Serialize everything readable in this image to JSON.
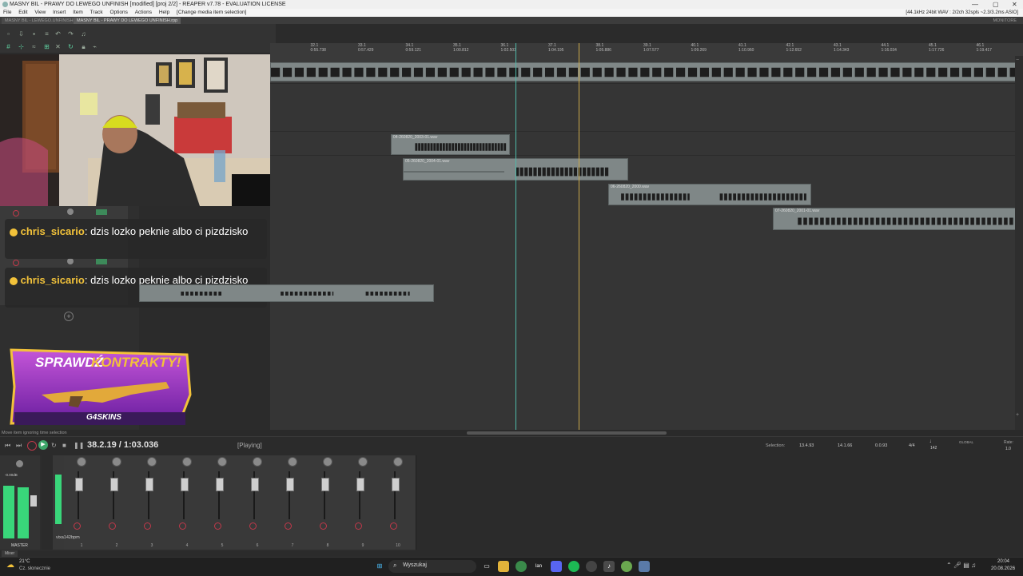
{
  "window": {
    "title": "MASNY BIL - PRAWY DO LEWEGO UNFINISH [modified] [proj 2/2] - REAPER v7.78 - EVALUATION LICENSE",
    "controls": [
      "—",
      "▢",
      "✕"
    ]
  },
  "menu": {
    "items": [
      "File",
      "Edit",
      "View",
      "Insert",
      "Item",
      "Track",
      "Options",
      "Actions",
      "Help"
    ],
    "status": "[Change media item selection]",
    "audio_info": "[44.1kHz 24bit WAV : 2/2ch 32spls ~2.3/3.2ms ASIO]"
  },
  "tabs": [
    "MASNY BIL - LEWEGO.UNFINISH.rpp",
    "MASNY BIL - PRAWY DO LEWEGO UNFINISH.rpp"
  ],
  "tabs_right": "MONITORE",
  "ruler": {
    "ticks": [
      {
        "bar": "29.1",
        "time": "0:51.500"
      },
      {
        "bar": "30.1",
        "time": "0:52.355"
      },
      {
        "bar": "31.1",
        "time": "0:54.047"
      },
      {
        "bar": "32.1",
        "time": "0:55.738"
      },
      {
        "bar": "33.1",
        "time": "0:57.429"
      },
      {
        "bar": "34.1",
        "time": "0:59.121"
      },
      {
        "bar": "35.1",
        "time": "1:00.812"
      },
      {
        "bar": "36.1",
        "time": "1:02.503"
      },
      {
        "bar": "37.1",
        "time": "1:04.195"
      },
      {
        "bar": "38.1",
        "time": "1:05.886"
      },
      {
        "bar": "39.1",
        "time": "1:07.577"
      },
      {
        "bar": "40.1",
        "time": "1:09.269"
      },
      {
        "bar": "41.1",
        "time": "1:10.960"
      },
      {
        "bar": "42.1",
        "time": "1:12.652"
      },
      {
        "bar": "43.1",
        "time": "1:14.343"
      },
      {
        "bar": "44.1",
        "time": "1:16.034"
      },
      {
        "bar": "45.1",
        "time": "1:17.726"
      },
      {
        "bar": "46.1",
        "time": "1:19.417"
      }
    ]
  },
  "items": {
    "item1": "04-260820_2003-01.wav",
    "item2": "05-260820_2004-01.wav",
    "item3": "06-260820_2000.wav",
    "item4": "07-260820_2001-01.wav"
  },
  "chat": [
    {
      "user": "chris_sicario",
      "message": "dzis lozko peknie albo ci pizdzisko"
    },
    {
      "user": "chris_sicario",
      "message": "dzis lozko peknie albo ci pizdzisko"
    }
  ],
  "ad": {
    "headline_1": "SPRAWDŹ",
    "headline_2": "KONTRAKTY!",
    "brand": "G4SKINS"
  },
  "status_line": "Move item ignoring time selection",
  "transport": {
    "position": "38.2.19 / 1:03.036",
    "state": "[Playing]",
    "selection_label": "Selection:",
    "selection_start": "13.4.93",
    "selection_end": "14.1.66",
    "selection_len": "0.0.93",
    "time_sig": "4/4",
    "bpm": "142",
    "global": "GLOBAL",
    "rate_label": "Rate:",
    "rate": "1.0"
  },
  "mixer": {
    "master_label": "MASTER",
    "master_value": "-0.00dB",
    "strip_label": "vixa142bpm",
    "channel_numbers": [
      "1",
      "2",
      "3",
      "4",
      "5",
      "6",
      "7",
      "8",
      "9",
      "10"
    ],
    "mixer_tab": "Mixer"
  },
  "taskbar": {
    "weather_temp": "21°C",
    "weather_desc": "Cz. słonecznie",
    "search_placeholder": "Wyszukaj",
    "time": "20:04",
    "date": "20.08.2026"
  },
  "colors": {
    "item_bg": "#7f8787",
    "waveform": "#1e1e1e",
    "playhead": "#caa84a",
    "edit_cursor": "#4fb9a8",
    "chat_user": "#f2c23a",
    "arm_red": "#c0394a",
    "meter_green": "#39d67a"
  }
}
